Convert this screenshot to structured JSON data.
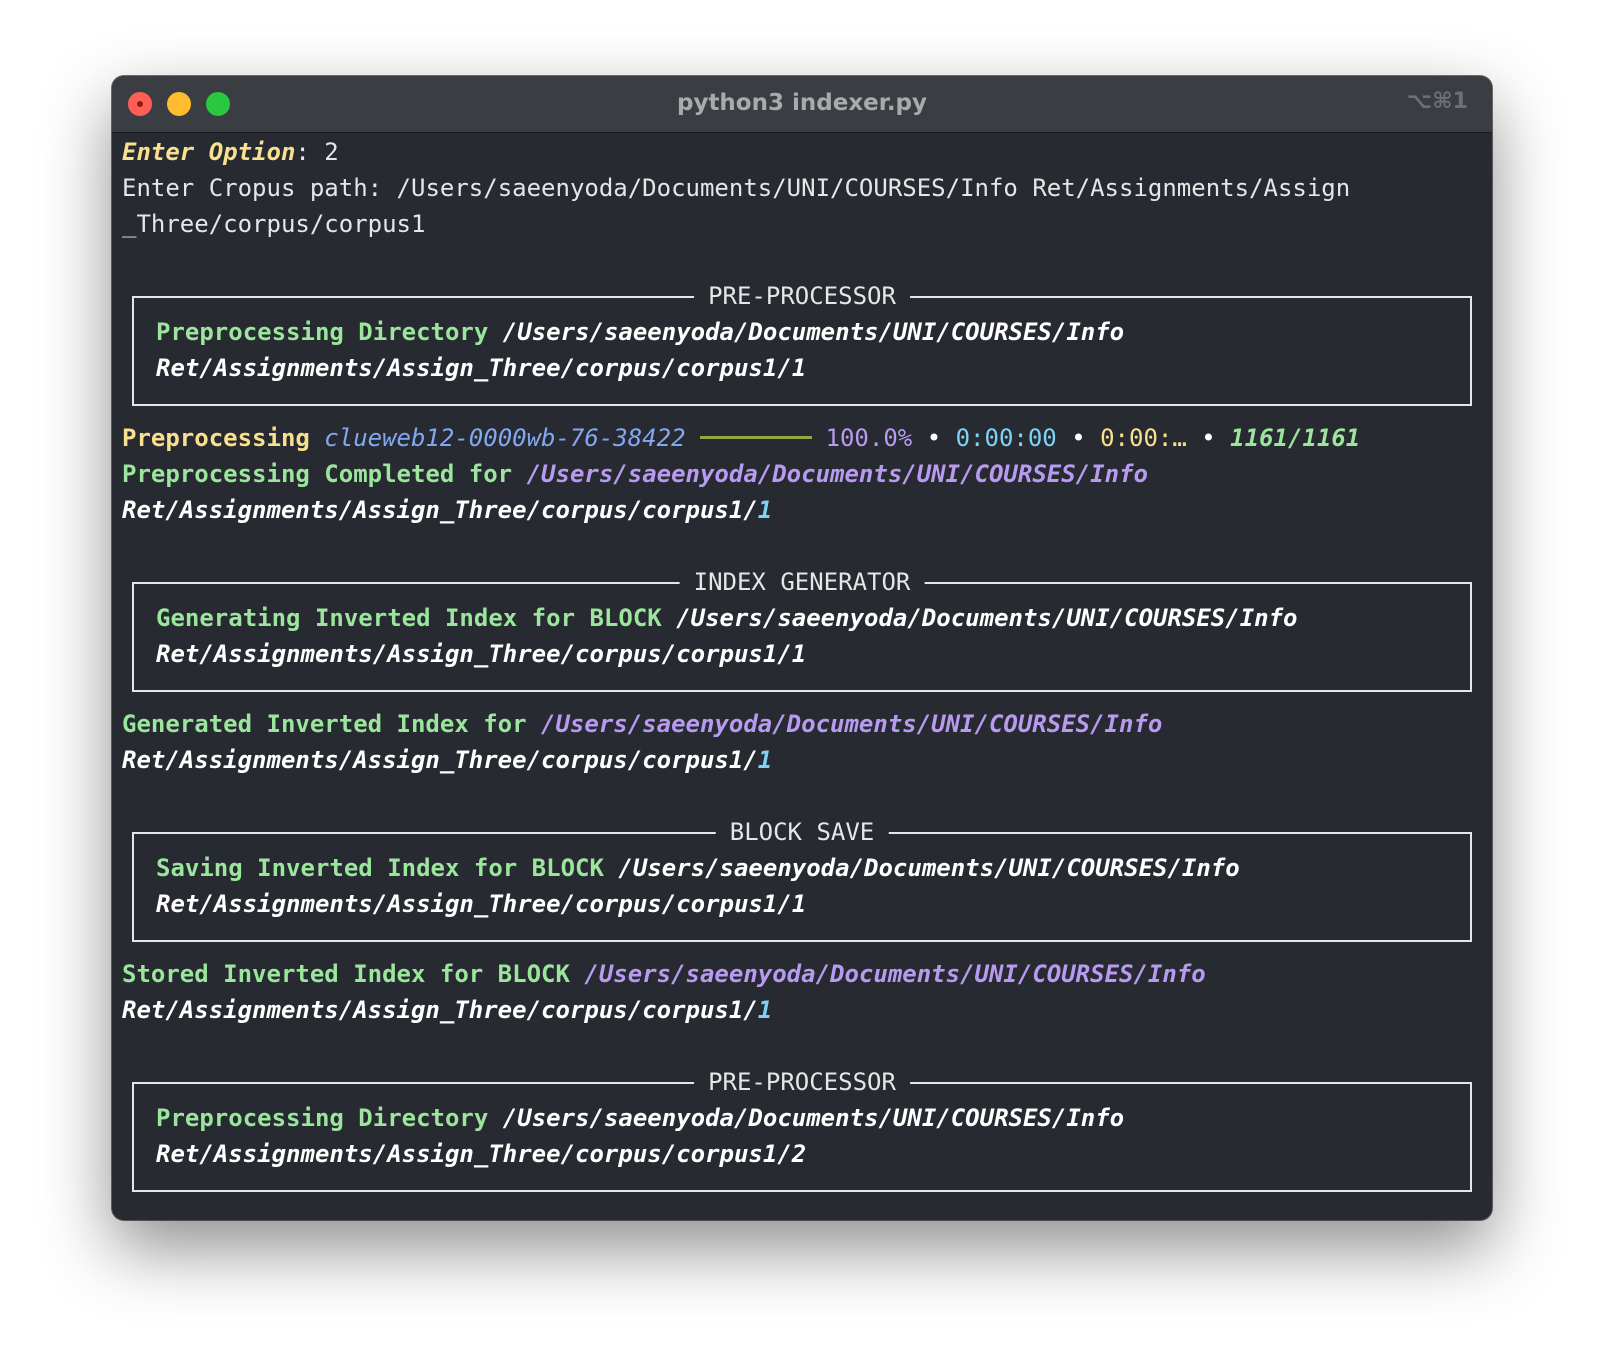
{
  "window": {
    "title": "python3 indexer.py",
    "shortcut": "⌥⌘1"
  },
  "prompt": {
    "option_label": "Enter Option",
    "option_sep": ": ",
    "option_value": "2",
    "path_label": "Enter Cropus path: ",
    "path_line1": "/Users/saeenyoda/Documents/UNI/COURSES/Info Ret/Assignments/Assign",
    "path_line2": "_Three/corpus/corpus1"
  },
  "panel1": {
    "title": "PRE-PROCESSOR",
    "label": "Preprocessing Directory",
    "path_line1": "/Users/saeenyoda/Documents/UNI/COURSES/Info",
    "path_line2": "Ret/Assignments/Assign_Three/corpus/corpus1/1"
  },
  "progress": {
    "label": "Preprocessing",
    "file": "clueweb12-0000wb-76-38422",
    "fraction": 1.0,
    "percent": "100.0%",
    "sep": "•",
    "elapsed": "0:00:00",
    "remaining": "0:00:…",
    "count": "1161/1161"
  },
  "completed": {
    "label": "Preprocessing Completed for",
    "path_line1": "/Users/saeenyoda/Documents/UNI/COURSES/Info",
    "path_line2_base": "Ret/Assignments/Assign_Three/corpus/corpus1/",
    "path_line2_num": "1"
  },
  "panel2": {
    "title": "INDEX GENERATOR",
    "label": "Generating Inverted Index for BLOCK",
    "path_line1": "/Users/saeenyoda/Documents/UNI/COURSES/Info",
    "path_line2": "Ret/Assignments/Assign_Three/corpus/corpus1/1"
  },
  "generated": {
    "label": "Generated Inverted Index for",
    "path_line1": "/Users/saeenyoda/Documents/UNI/COURSES/Info",
    "path_line2_base": "Ret/Assignments/Assign_Three/corpus/corpus1/",
    "path_line2_num": "1"
  },
  "panel3": {
    "title": "BLOCK SAVE",
    "label": "Saving Inverted Index for BLOCK",
    "path_line1": "/Users/saeenyoda/Documents/UNI/COURSES/Info",
    "path_line2": "Ret/Assignments/Assign_Three/corpus/corpus1/1"
  },
  "stored": {
    "label": "Stored Inverted Index for BLOCK",
    "path_line1": "/Users/saeenyoda/Documents/UNI/COURSES/Info",
    "path_line2_base": "Ret/Assignments/Assign_Three/corpus/corpus1/",
    "path_line2_num": "1"
  },
  "panel4": {
    "title": "PRE-PROCESSOR",
    "label": "Preprocessing Directory",
    "path_line1": "/Users/saeenyoda/Documents/UNI/COURSES/Info",
    "path_line2": "Ret/Assignments/Assign_Three/corpus/corpus1/2"
  }
}
